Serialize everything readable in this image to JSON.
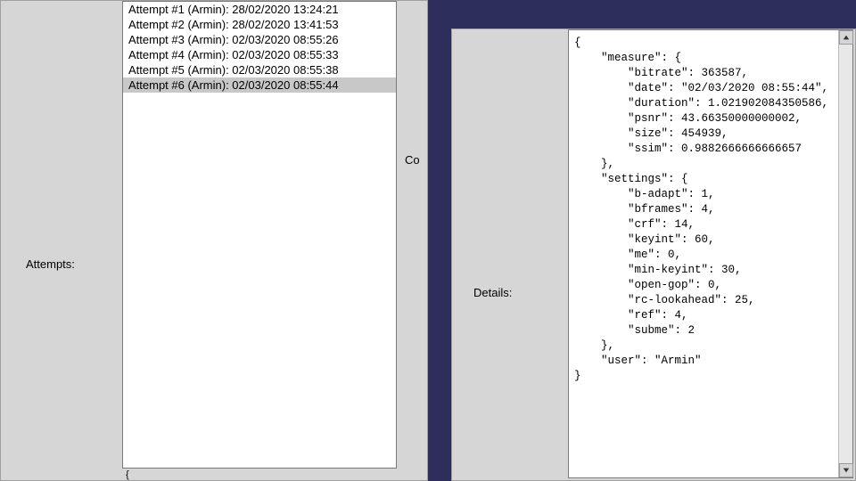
{
  "attempts": {
    "label": "Attempts:",
    "items": [
      {
        "text": "Attempt #1 (Armin): 28/02/2020 13:24:21",
        "selected": false
      },
      {
        "text": "Attempt #2 (Armin): 28/02/2020 13:41:53",
        "selected": false
      },
      {
        "text": "Attempt #3 (Armin): 02/03/2020 08:55:26",
        "selected": false
      },
      {
        "text": "Attempt #4 (Armin): 02/03/2020 08:55:33",
        "selected": false
      },
      {
        "text": "Attempt #5 (Armin): 02/03/2020 08:55:38",
        "selected": false
      },
      {
        "text": "Attempt #6 (Armin): 02/03/2020 08:55:44",
        "selected": true
      }
    ],
    "bottom_snippet": "{"
  },
  "cut_label": "Co",
  "details": {
    "label": "Details:",
    "json_text": "{\n    \"measure\": {\n        \"bitrate\": 363587,\n        \"date\": \"02/03/2020 08:55:44\",\n        \"duration\": 1.021902084350586,\n        \"psnr\": 43.66350000000002,\n        \"size\": 454939,\n        \"ssim\": 0.9882666666666657\n    },\n    \"settings\": {\n        \"b-adapt\": 1,\n        \"bframes\": 4,\n        \"crf\": 14,\n        \"keyint\": 60,\n        \"me\": 0,\n        \"min-keyint\": 30,\n        \"open-gop\": 0,\n        \"rc-lookahead\": 25,\n        \"ref\": 4,\n        \"subme\": 2\n    },\n    \"user\": \"Armin\"\n}"
  }
}
